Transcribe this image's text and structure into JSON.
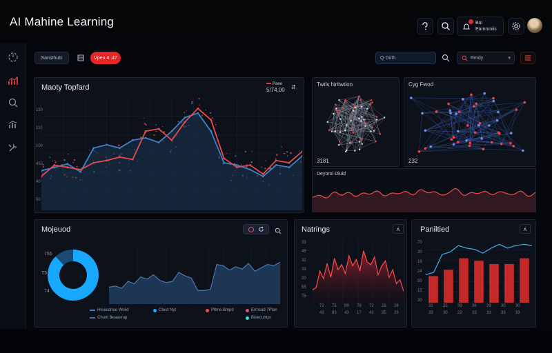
{
  "app": {
    "title": "AI Mahine Learning"
  },
  "header": {
    "notification": {
      "line1": "Bui",
      "line2": "Eammniis"
    }
  },
  "toolbar": {
    "filter_label": "Sansthuts",
    "live_label": "Vpeu 4 .47",
    "search_placeholder": "Q Dirth",
    "select_value": "Rmdy",
    "select_chevron": "▾"
  },
  "main_chart": {
    "title": "Maoty Topfard",
    "legend": "Paee",
    "value": "5/74.00",
    "y_ticks": [
      "150",
      "110",
      "100",
      "450",
      "40",
      "50"
    ],
    "chart_data": {
      "type": "line",
      "x": [
        0,
        1,
        2,
        3,
        4,
        5,
        6,
        7,
        8,
        9,
        10,
        11,
        12,
        13,
        14,
        15,
        16,
        17,
        18,
        19,
        20
      ],
      "series": [
        {
          "values": [
            30,
            40,
            38,
            36,
            42,
            44,
            47,
            45,
            70,
            72,
            62,
            78,
            90,
            80,
            46,
            38,
            40,
            32,
            44,
            42,
            52
          ],
          "color": "#e84b4b"
        },
        {
          "values": [
            35,
            38,
            41,
            34,
            55,
            58,
            55,
            62,
            64,
            60,
            70,
            82,
            86,
            70,
            42,
            40,
            36,
            30,
            40,
            38,
            48
          ],
          "color": "#3f83c7"
        }
      ],
      "ylim": [
        0,
        100
      ]
    }
  },
  "network_small": {
    "label": "Twtls hirltwtion",
    "value": "3181"
  },
  "network_large": {
    "label": "Cyg Fwod",
    "value": "232"
  },
  "wave_chart": {
    "label": "Deyoroi Diuid",
    "chart_data": {
      "type": "area",
      "values": [
        40,
        48,
        34,
        60,
        42,
        58,
        38,
        55,
        46,
        62,
        40,
        54,
        48,
        60,
        42,
        66,
        50,
        58,
        44,
        52,
        70,
        40,
        56,
        48,
        60,
        44,
        58,
        50,
        46,
        62,
        38,
        54
      ],
      "ylim": [
        0,
        100
      ]
    }
  },
  "donut_panel": {
    "title": "Mojeuod",
    "donut_labels": [
      "755",
      "T5",
      "74"
    ],
    "legend": [
      "Heuostnue Woiid",
      "Chunt Beaasrup",
      "Cteut Nyt",
      "Pltme Bmpd",
      "Ermsod 7Plan",
      "Bioecumpr"
    ],
    "chart_data": {
      "type": "pie",
      "values": [
        88,
        12
      ],
      "colors": [
        "#19a8ff",
        "#1b4a72"
      ]
    },
    "area_chart_data": {
      "type": "area",
      "values": [
        30,
        32,
        28,
        40,
        36,
        48,
        44,
        52,
        42,
        38,
        40,
        56,
        50,
        46,
        24,
        24,
        26,
        70,
        68,
        60,
        66,
        62,
        72,
        58,
        64,
        70,
        68,
        74
      ],
      "ylim": [
        0,
        100
      ]
    }
  },
  "nathings_panel": {
    "title": "Natrings",
    "chevron": "∧",
    "y_ticks": [
      "33",
      "45",
      "32",
      "33",
      "20",
      "55",
      "75"
    ],
    "x_ticks": [
      "72",
      "75",
      "99",
      "79",
      "72",
      "26",
      "28"
    ],
    "x_sub": [
      "43",
      "83",
      "43",
      "17",
      "43",
      "85",
      "23"
    ],
    "chart_data": {
      "type": "area",
      "values": [
        20,
        24,
        50,
        38,
        62,
        40,
        70,
        52,
        60,
        46,
        74,
        58,
        68,
        50,
        82,
        64,
        60,
        72,
        44,
        58,
        66,
        40,
        52,
        30,
        36,
        18
      ],
      "ylim": [
        0,
        100
      ]
    }
  },
  "partitioned_panel": {
    "title": "Paniltied",
    "chevron": "∧",
    "y_ticks": [
      "70",
      "30",
      "19",
      "24",
      "50",
      "15",
      "30"
    ],
    "x_ticks": [
      "31",
      "35",
      "39",
      "36",
      "29",
      "30",
      "30"
    ],
    "x_sub": [
      "33",
      "30",
      "22",
      "33",
      "33",
      "33",
      "33"
    ],
    "chart_data": {
      "type": "bar",
      "categories": [
        "31",
        "35",
        "39",
        "36",
        "29",
        "30",
        "30"
      ],
      "values": [
        42,
        52,
        70,
        66,
        61,
        61,
        70
      ],
      "line_values": [
        44,
        48,
        76,
        80,
        90,
        86,
        84,
        78,
        86,
        92,
        86,
        90,
        92,
        90
      ],
      "ylim": [
        0,
        100
      ]
    }
  }
}
